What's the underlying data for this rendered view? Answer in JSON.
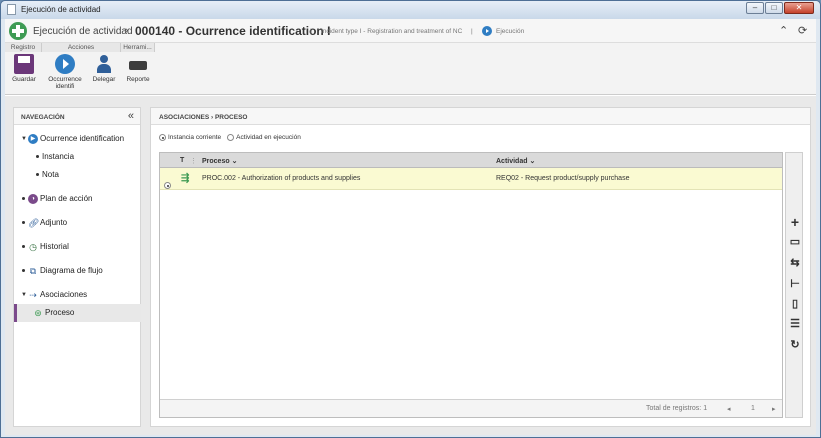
{
  "window": {
    "title": "Ejecución de actividad",
    "minimize": "–",
    "maximize": "□",
    "close": "✕"
  },
  "header": {
    "crumb": "Ejecución de actividad",
    "separator": "›",
    "record_title": "000140 - Ocurrence identification I",
    "subtitle": "Incident type I - Registration and treatment of NC",
    "divider": "|",
    "status": "Ejecución",
    "collapse_icon": "⌃",
    "refresh_icon": "⟳"
  },
  "ribbon": {
    "groups": [
      "Registro",
      "Acciones",
      "Herrami..."
    ],
    "buttons": {
      "save": "Guardar",
      "occurrence_line1": "Occurrence",
      "occurrence_line2": "identifi",
      "delegate": "Delegar",
      "report": "Reporte"
    }
  },
  "nav": {
    "title": "NAVEGACIÓN",
    "collapse": "«",
    "items": [
      {
        "label": "Ocurrence identification"
      },
      {
        "label": "Instancia"
      },
      {
        "label": "Nota"
      },
      {
        "label": "Plan de acción"
      },
      {
        "label": "Adjunto"
      },
      {
        "label": "Historial"
      },
      {
        "label": "Diagrama de flujo"
      },
      {
        "label": "Asociaciones"
      },
      {
        "label": "Proceso"
      }
    ]
  },
  "content": {
    "breadcrumb": "ASOCIACIONES  ›  PROCESO",
    "radio_current": "Instancia corriente",
    "radio_running": "Actividad en ejecución",
    "columns": {
      "type": "T",
      "process": "Proceso ⌄",
      "activity": "Actividad ⌄"
    },
    "rows": [
      {
        "process": "PROC.002 - Authorization of products and supplies",
        "activity": "REQ02 - Request product/supply purchase"
      }
    ],
    "footer": {
      "total": "Total de registros: 1",
      "prev": "◂",
      "page": "1",
      "next": "▸"
    }
  },
  "tools": [
    "add-icon",
    "view-icon",
    "associate-icon",
    "tree-icon",
    "delete-icon",
    "list-icon",
    "refresh-icon"
  ],
  "colors": {
    "accent": "#2f7dc3",
    "selected_row": "#fafad2",
    "nav_selected_border": "#7b4a8b"
  }
}
